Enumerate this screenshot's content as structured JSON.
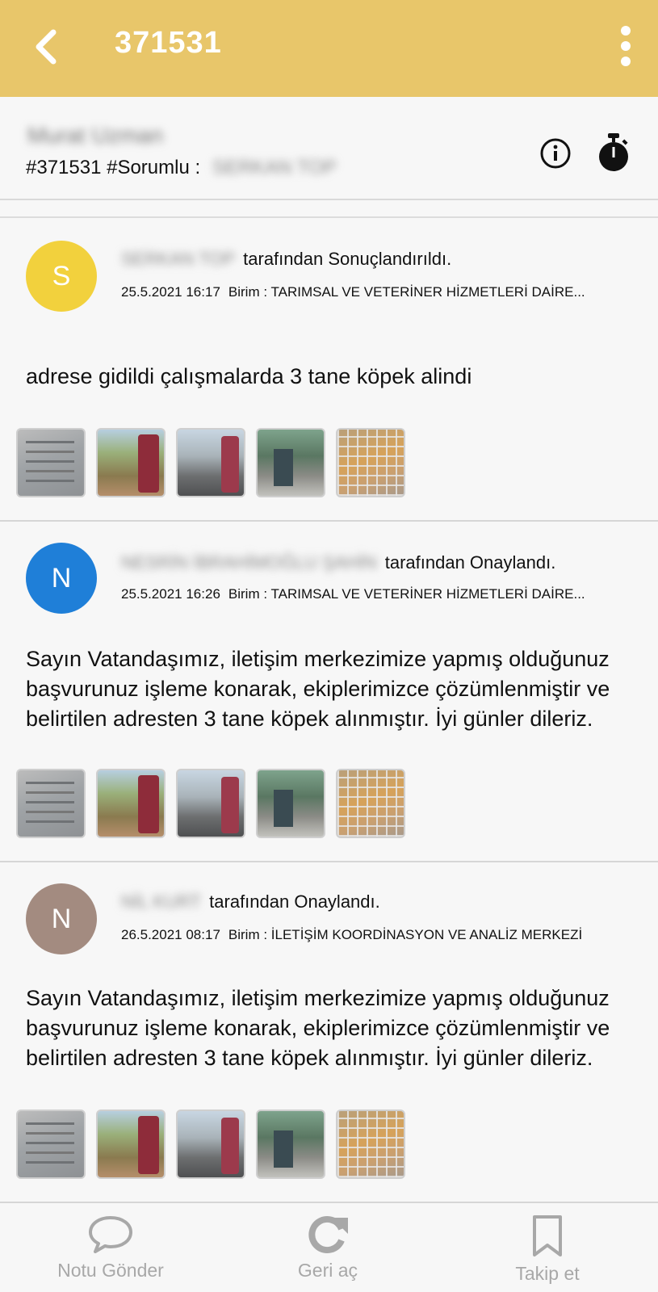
{
  "appbar": {
    "title": "371531"
  },
  "header": {
    "name": "Murat Uzman",
    "ticket_tag": "#371531 #Sorumlu :",
    "responsible": "SERKAN TOP"
  },
  "notes": [
    {
      "avatar_letter": "S",
      "avatar_color": "#f2d13d",
      "author": "SERKAN TOP",
      "action": "tarafından Sonuçlandırıldı.",
      "datetime": "25.5.2021 16:17",
      "unit": "Birim : TARIMSAL VE VETERİNER HİZMETLERİ DAİRE...",
      "text": "adrese gidildi çalışmalarda 3 tane köpek alindi"
    },
    {
      "avatar_letter": "N",
      "avatar_color": "#1f7fd8",
      "author": "NESRİN İBRAHİMOĞLU ŞAHİN",
      "action": "tarafından Onaylandı.",
      "datetime": "25.5.2021 16:26",
      "unit": "Birim : TARIMSAL VE VETERİNER HİZMETLERİ DAİRE...",
      "text": "Sayın Vatandaşımız, iletişim merkezimize yapmış olduğunuz başvurunuz işleme konarak, ekiplerimizce çözümlenmiştir ve belirtilen adresten 3 tane  köpek alınmıştır. İyi günler dileriz."
    },
    {
      "avatar_letter": "N",
      "avatar_color": "#a38b80",
      "author": "NİL KURT",
      "action": "tarafından Onaylandı.",
      "datetime": "26.5.2021 08:17",
      "unit": "Birim : İLETİŞİM KOORDİNASYON VE ANALİZ MERKEZİ",
      "text": "Sayın Vatandaşımız, iletişim merkezimize yapmış olduğunuz başvurunuz işleme konarak, ekiplerimizce çözümlenmiştir ve belirtilen adresten 3 tane  köpek alınmıştır. İyi günler dileriz."
    }
  ],
  "bottombar": {
    "send_note": "Notu Gönder",
    "reopen": "Geri aç",
    "follow": "Takip et"
  },
  "colors": {
    "appbar": "#e8c66a",
    "inactive": "#a8a8a8"
  },
  "icons": [
    "back-arrow-icon",
    "more-vert-icon",
    "info-icon",
    "timer-icon",
    "chat-bubble-icon",
    "refresh-icon",
    "bookmark-icon"
  ]
}
